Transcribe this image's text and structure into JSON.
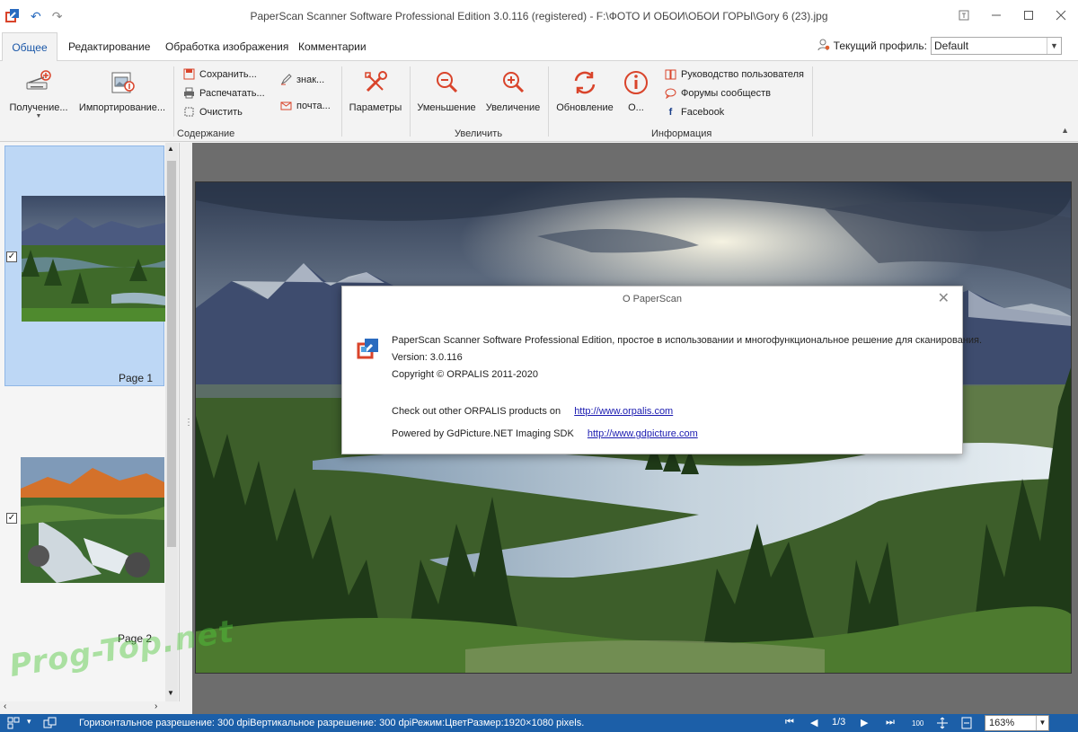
{
  "window": {
    "title": "PaperScan Scanner Software Professional Edition 3.0.116 (registered) - F:\\ФОТО И ОБОИ\\ОБОИ ГОРЫ\\Gory 6 (23).jpg"
  },
  "tabs": [
    {
      "label": "Общее",
      "active": true
    },
    {
      "label": "Редактирование"
    },
    {
      "label": "Обработка изображения"
    },
    {
      "label": "Комментарии"
    }
  ],
  "profile": {
    "label": "Текущий профиль:",
    "value": "Default"
  },
  "ribbon": {
    "acquire": "Получение...",
    "import": "Импортирование...",
    "save": "Сохранить...",
    "print": "Распечатать...",
    "clear": "Очистить",
    "sign": "знак...",
    "mail": "почта...",
    "settings": "Параметры",
    "zoom_out": "Уменьшение",
    "zoom_in": "Увеличение",
    "update": "Обновление",
    "about": "О...",
    "user_guide": "Руководство пользователя",
    "forums": "Форумы сообществ",
    "facebook": "Facebook",
    "group_content": "Содержание",
    "group_zoom": "Увеличить",
    "group_info": "Информация"
  },
  "thumbnails": [
    {
      "label": "Page 1",
      "checked": true,
      "selected": true
    },
    {
      "label": "Page 2",
      "checked": true,
      "selected": false
    }
  ],
  "dialog": {
    "title": "О PaperScan",
    "line1": "PaperScan Scanner Software Professional Edition, простое в использовании и многофункциональное решение для сканирования.",
    "version": "Version: 3.0.116",
    "copyright": "Copyright © ORPALIS 2011-2020",
    "products_text": "Check out other ORPALIS products on",
    "products_link": "http://www.orpalis.com",
    "powered_text": "Powered by GdPicture.NET Imaging SDK",
    "powered_link": "http://www.gdpicture.com"
  },
  "status": {
    "text": "Горизонтальное разрешение: 300 dpiВертикальное разрешение: 300 dpiРежим:ЦветРазмер:1920×1080 pixels.",
    "page": "1/3",
    "zoom": "163%"
  },
  "watermark": "Prog-Top.net",
  "colors": {
    "accent": "#1c5fa8",
    "tab_active": "#1a57a8",
    "selection": "#bdd7f5",
    "icon_red": "#d9442b"
  }
}
